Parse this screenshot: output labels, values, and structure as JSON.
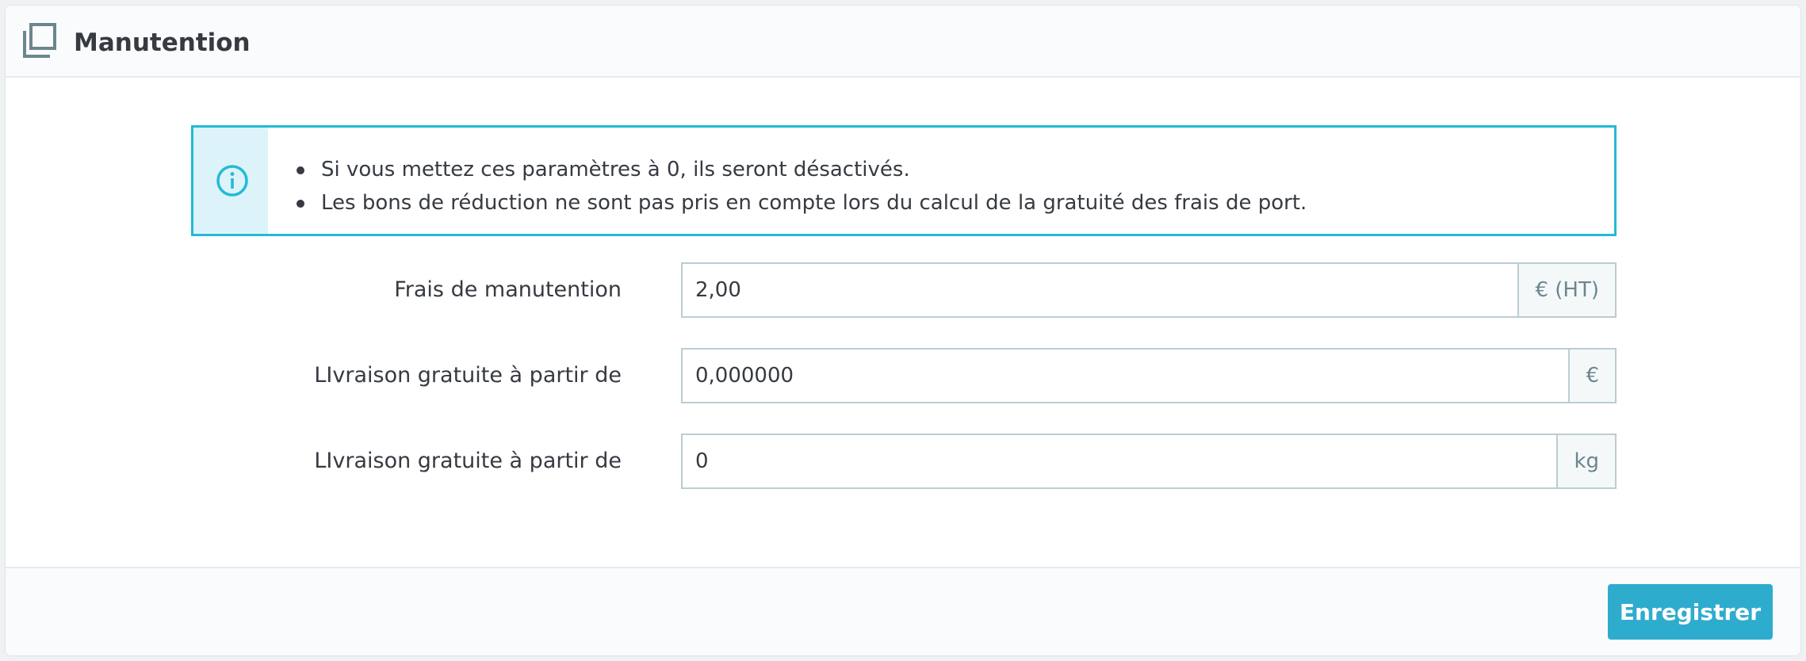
{
  "header": {
    "title": "Manutention",
    "icon": "copy-icon"
  },
  "alert": {
    "icon": "info-icon",
    "items": [
      "Si vous mettez ces paramètres à 0, ils seront désactivés.",
      "Les bons de réduction ne sont pas pris en compte lors du calcul de la gratuité des frais de port."
    ]
  },
  "form": {
    "fields": [
      {
        "label": "Frais de manutention",
        "value": "2,00",
        "addon": "€ (HT)"
      },
      {
        "label": "LIvraison gratuite à partir de",
        "value": "0,000000",
        "addon": "€"
      },
      {
        "label": "LIvraison gratuite à partir de",
        "value": "0",
        "addon": "kg"
      }
    ]
  },
  "footer": {
    "save_label": "Enregistrer"
  },
  "colors": {
    "accent": "#25b9d7",
    "button": "#2eacce",
    "info_bg": "#dcf4f9"
  }
}
